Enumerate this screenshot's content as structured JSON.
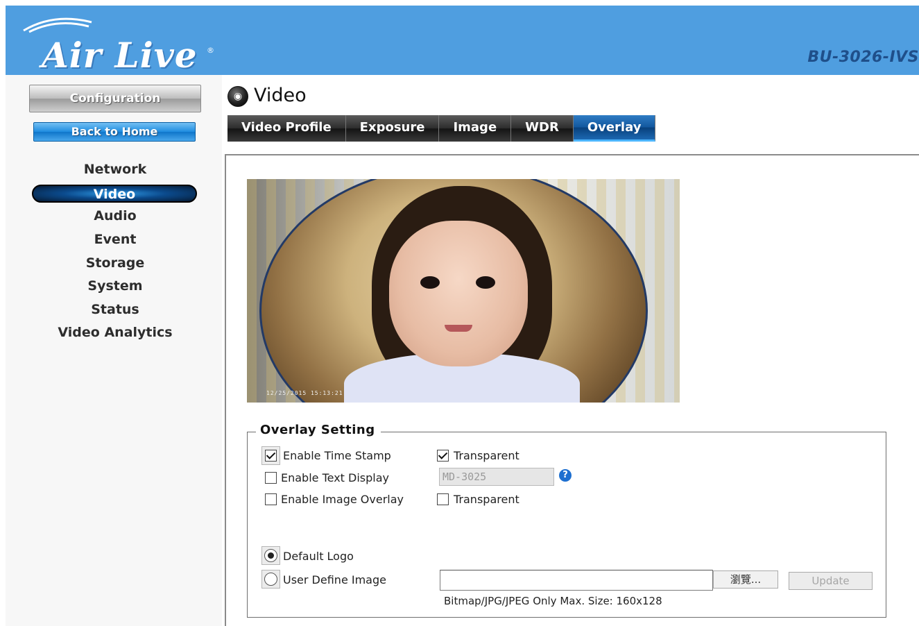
{
  "header": {
    "logo_text": "Air Live",
    "logo_reg": "®",
    "model": "BU-3026-IVS"
  },
  "sidebar": {
    "config_label": "Configuration",
    "home_label": "Back to Home",
    "items": [
      {
        "label": "Network",
        "active": false
      },
      {
        "label": "Video",
        "active": true
      },
      {
        "label": "Audio",
        "active": false
      },
      {
        "label": "Event",
        "active": false
      },
      {
        "label": "Storage",
        "active": false
      },
      {
        "label": "System",
        "active": false
      },
      {
        "label": "Status",
        "active": false
      },
      {
        "label": "Video Analytics",
        "active": false
      }
    ]
  },
  "page": {
    "title": "Video",
    "tabs": [
      {
        "label": "Video Profile",
        "active": false
      },
      {
        "label": "Exposure",
        "active": false
      },
      {
        "label": "Image",
        "active": false
      },
      {
        "label": "WDR",
        "active": false
      },
      {
        "label": "Overlay",
        "active": true
      }
    ]
  },
  "video": {
    "timestamp": "12/25/2015 15:13:21"
  },
  "overlay": {
    "legend": "Overlay Setting",
    "timestamp": {
      "label": "Enable Time Stamp",
      "checked": true,
      "transparent_label": "Transparent",
      "transparent_checked": true
    },
    "text_display": {
      "label": "Enable Text Display",
      "checked": false,
      "value": "MD-3025"
    },
    "image_overlay": {
      "label": "Enable Image Overlay",
      "checked": false,
      "transparent_label": "Transparent",
      "transparent_checked": false
    },
    "default_logo": {
      "label": "Default Logo",
      "selected": true
    },
    "user_image": {
      "label": "User Define Image",
      "selected": false
    },
    "browse_label": "瀏覽...",
    "update_label": "Update",
    "file_hint": "Bitmap/JPG/JPEG Only Max. Size: 160x128"
  },
  "colors": {
    "header_bg": "#4f9ee0",
    "active_tab": "#12579e",
    "help_icon": "#1d6fd0"
  },
  "icons": [
    "camera-icon",
    "help-icon",
    "checkbox-icon",
    "radio-icon"
  ]
}
